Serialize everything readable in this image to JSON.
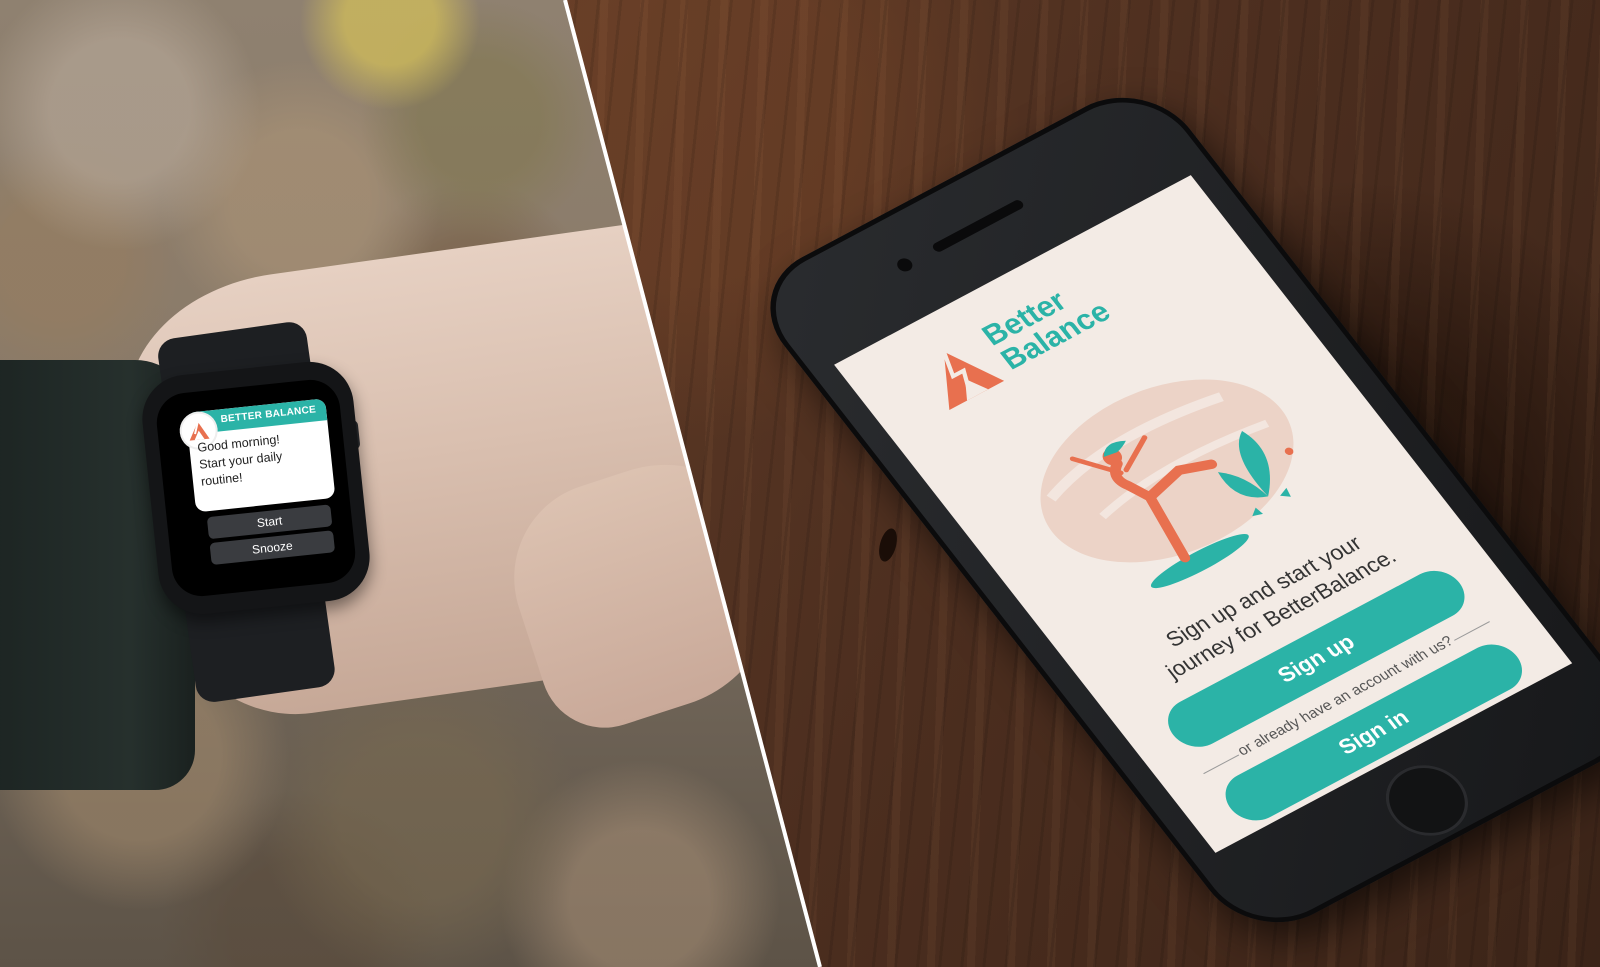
{
  "watch": {
    "brand": "BETTER BALANCE",
    "message_line1": "Good morning!",
    "message_line2": "Start your daily",
    "message_line3": "routine!",
    "start_label": "Start",
    "snooze_label": "Snooze"
  },
  "phone": {
    "brand_line1": "Better",
    "brand_line2": "Balance",
    "headline_line1": "Sign up and start your",
    "headline_line2": "journey for BetterBalance.",
    "signup_label": "Sign up",
    "or_text": "or already have an account with us?",
    "signin_label": "Sign in"
  },
  "colors": {
    "brand_teal": "#2bb3a7",
    "brand_coral": "#e8704f",
    "screen_bg": "#f3ebe5"
  }
}
